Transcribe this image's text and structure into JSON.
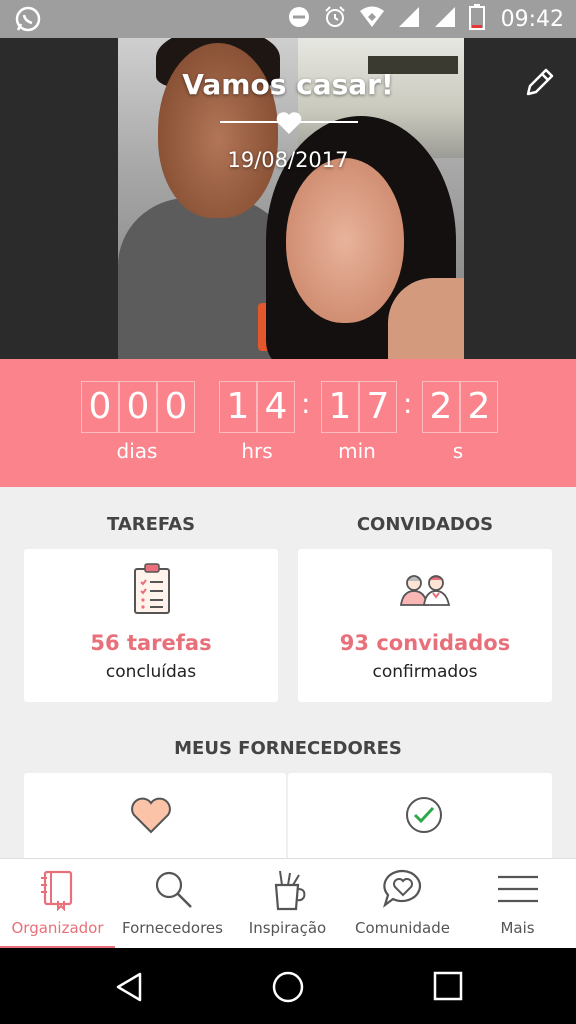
{
  "status_bar": {
    "time": "09:42",
    "left_icon": "whatsapp-icon",
    "right_icons": [
      "do-not-disturb-icon",
      "alarm-icon",
      "wifi-icon",
      "signal-icon",
      "signal-icon",
      "battery-icon"
    ]
  },
  "header": {
    "title": "Vamos casar!",
    "date": "19/08/2017",
    "edit_icon": "pencil-icon"
  },
  "countdown": {
    "days": [
      "0",
      "0",
      "0"
    ],
    "hours": [
      "1",
      "4"
    ],
    "minutes": [
      "1",
      "7"
    ],
    "seconds": [
      "2",
      "2"
    ],
    "labels": {
      "days": "dias",
      "hours": "hrs",
      "minutes": "min",
      "seconds": "s"
    }
  },
  "tasks": {
    "heading": "TAREFAS",
    "value": "56 tarefas",
    "sub": "concluídas",
    "icon": "clipboard-checklist-icon"
  },
  "guests": {
    "heading": "CONVIDADOS",
    "value": "93 convidados",
    "sub": "confirmados",
    "icon": "guests-couple-icon"
  },
  "vendors": {
    "heading": "MEUS FORNECEDORES",
    "left_icon": "heart-icon",
    "right_icon": "check-circle-icon"
  },
  "bottom_nav": [
    {
      "label": "Organizador",
      "icon": "notebook-icon",
      "active": true
    },
    {
      "label": "Fornecedores",
      "icon": "search-icon",
      "active": false
    },
    {
      "label": "Inspiração",
      "icon": "pencil-cup-icon",
      "active": false
    },
    {
      "label": "Comunidade",
      "icon": "heart-chat-icon",
      "active": false
    },
    {
      "label": "Mais",
      "icon": "menu-icon",
      "active": false
    }
  ],
  "colors": {
    "accent": "#fb838b",
    "accent_text": "#e8707a",
    "status_bar": "#9e9e9e"
  }
}
